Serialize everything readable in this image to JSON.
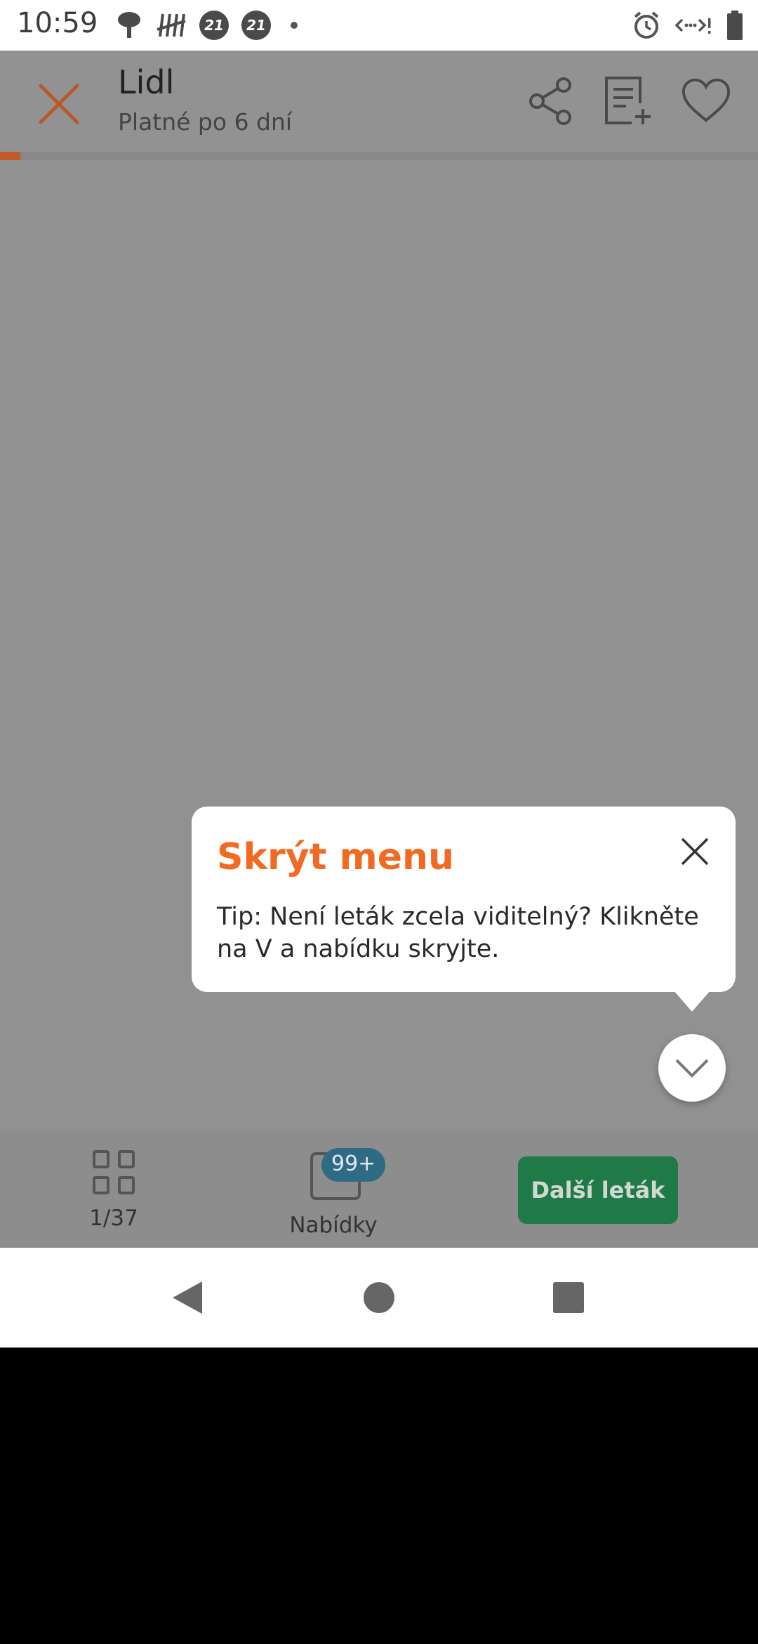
{
  "status_bar": {
    "time": "10:59",
    "left_icons": [
      "weather-icon",
      "tally-icon",
      "app-21-icon",
      "app-21-icon",
      "dot-icon"
    ],
    "badge_text": "21",
    "right_icons": [
      "alarm-icon",
      "data-saver-icon",
      "battery-icon"
    ]
  },
  "header": {
    "title": "Lidl",
    "subtitle": "Platné po 6 dní",
    "accent_color": "#f26a21"
  },
  "progress": {
    "current_page": 1,
    "total_pages": 37,
    "fraction": 0.027
  },
  "tooltip": {
    "title": "Skrýt menu",
    "text": "Tip: Není leták zcela viditelný? Klikněte na V a nabídku skryjte."
  },
  "bottom_bar": {
    "pages_label": "1/37",
    "offers_label": "Nabídky",
    "offers_badge": "99+",
    "next_button_label": "Další leták",
    "next_button_color": "#1f7a47"
  },
  "nav_bar": {
    "buttons": [
      "back",
      "home",
      "recents"
    ]
  }
}
